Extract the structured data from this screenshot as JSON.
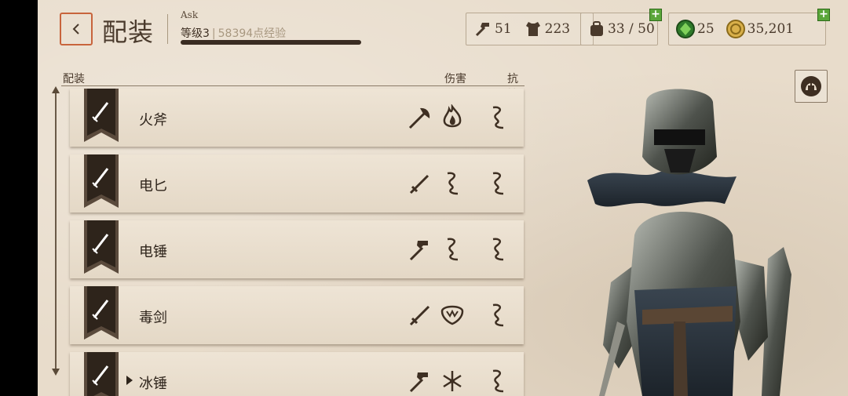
{
  "header": {
    "title": "配装",
    "player_name": "Ask",
    "level_label": "等级3",
    "separator": "|",
    "xp_label": "58394点经验",
    "xp_progress": 1.0
  },
  "resources": {
    "materials_a": "51",
    "materials_b": "223",
    "inventory": "33 / 50",
    "gems": "25",
    "gold": "35,201",
    "add_icon": "+"
  },
  "list": {
    "col_name": "配装",
    "col_damage": "伤害",
    "col_resist": "抗性",
    "rows": [
      {
        "name": "火斧",
        "dmg_weapon": "axe-icon",
        "dmg_type": "fire-icon",
        "resist": "shock-icon"
      },
      {
        "name": "电匕",
        "dmg_weapon": "dagger-icon",
        "dmg_type": "shock-icon",
        "resist": "shock-icon"
      },
      {
        "name": "电锤",
        "dmg_weapon": "hammer-icon",
        "dmg_type": "shock-icon",
        "resist": "shock-icon"
      },
      {
        "name": "毒剑",
        "dmg_weapon": "sword-icon",
        "dmg_type": "poison-icon",
        "resist": "shock-icon"
      },
      {
        "name": "冰锤",
        "dmg_weapon": "hammer-icon",
        "dmg_type": "frost-icon",
        "resist": "shock-icon"
      }
    ]
  },
  "colors": {
    "accent": "#c8643c",
    "plus_green": "#5aa63a",
    "parchment": "#e8dccb",
    "ink": "#2e241b"
  }
}
